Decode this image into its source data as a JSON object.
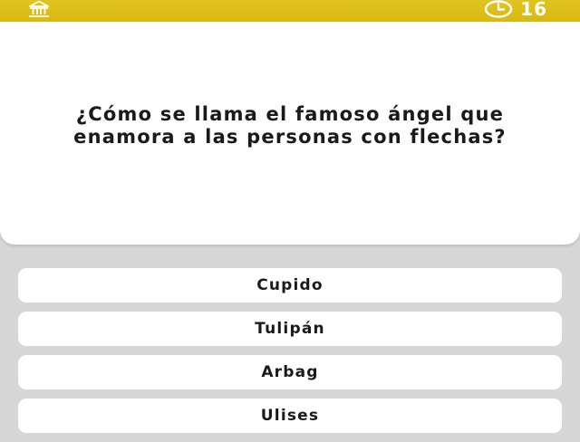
{
  "topbar": {
    "color": "#dcbd16",
    "home_icon": "home-building-icon",
    "timer": {
      "icon": "clock-icon",
      "value": "16"
    }
  },
  "question": {
    "text": "¿Cómo se llama el famoso ángel que enamora a las personas con flechas?"
  },
  "answers": [
    {
      "label": "Cupido"
    },
    {
      "label": "Tulipán"
    },
    {
      "label": "Arbag"
    },
    {
      "label": "Ulises"
    }
  ]
}
